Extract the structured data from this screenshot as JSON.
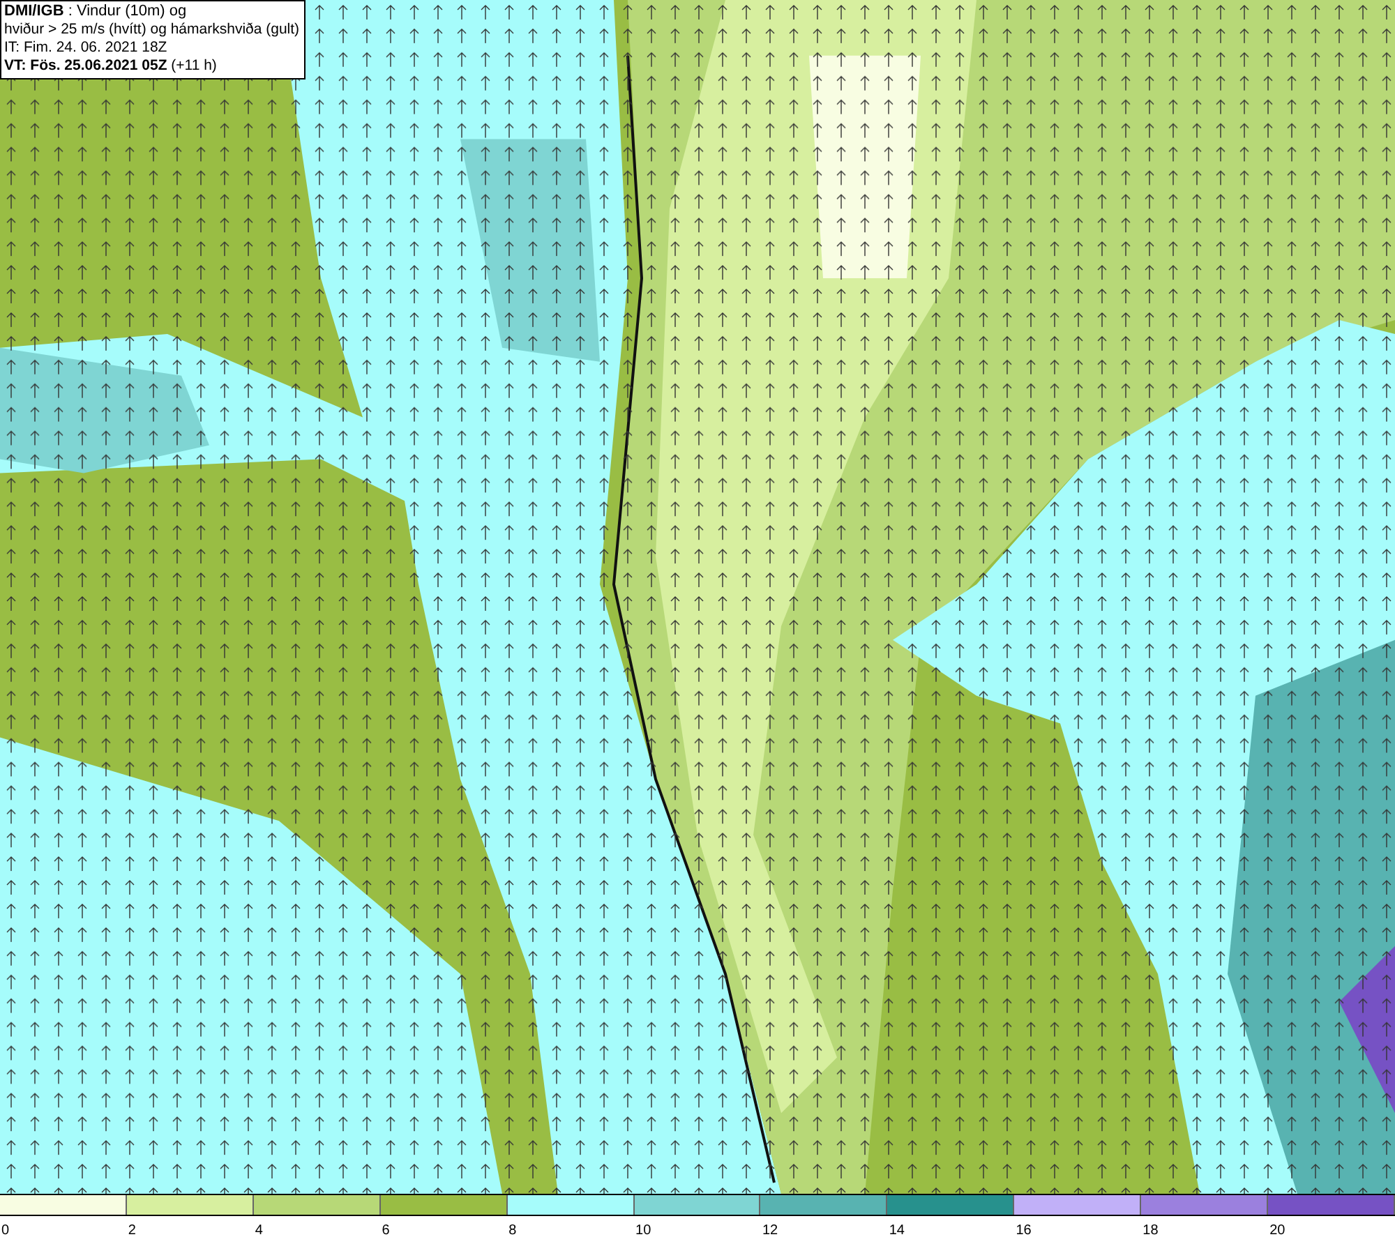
{
  "title_box": {
    "lines": [
      "**DMI/IGB** : Vindur (10m) og",
      "hviður > 25 m/s (hvítt) og hámarkshviða (gult)",
      "IT: Fim. 24. 06. 2021 18Z",
      "**VT: Fös. 25.06.2021 05Z** (+11 h)"
    ]
  },
  "legend": [
    {
      "label": "0",
      "color": "#f8fde2"
    },
    {
      "label": "2",
      "color": "#d7ef9f"
    },
    {
      "label": "4",
      "color": "#b7d877"
    },
    {
      "label": "6",
      "color": "#99bd44"
    },
    {
      "label": "8",
      "color": "#a6fcfb"
    },
    {
      "label": "10",
      "color": "#7fd5d3"
    },
    {
      "label": "12",
      "color": "#58b3b1"
    },
    {
      "label": "14",
      "color": "#27918d"
    },
    {
      "label": "16",
      "color": "#c1b0f8"
    },
    {
      "label": "18",
      "color": "#9b80de"
    },
    {
      "label": "20",
      "color": "#7652c4"
    }
  ]
}
